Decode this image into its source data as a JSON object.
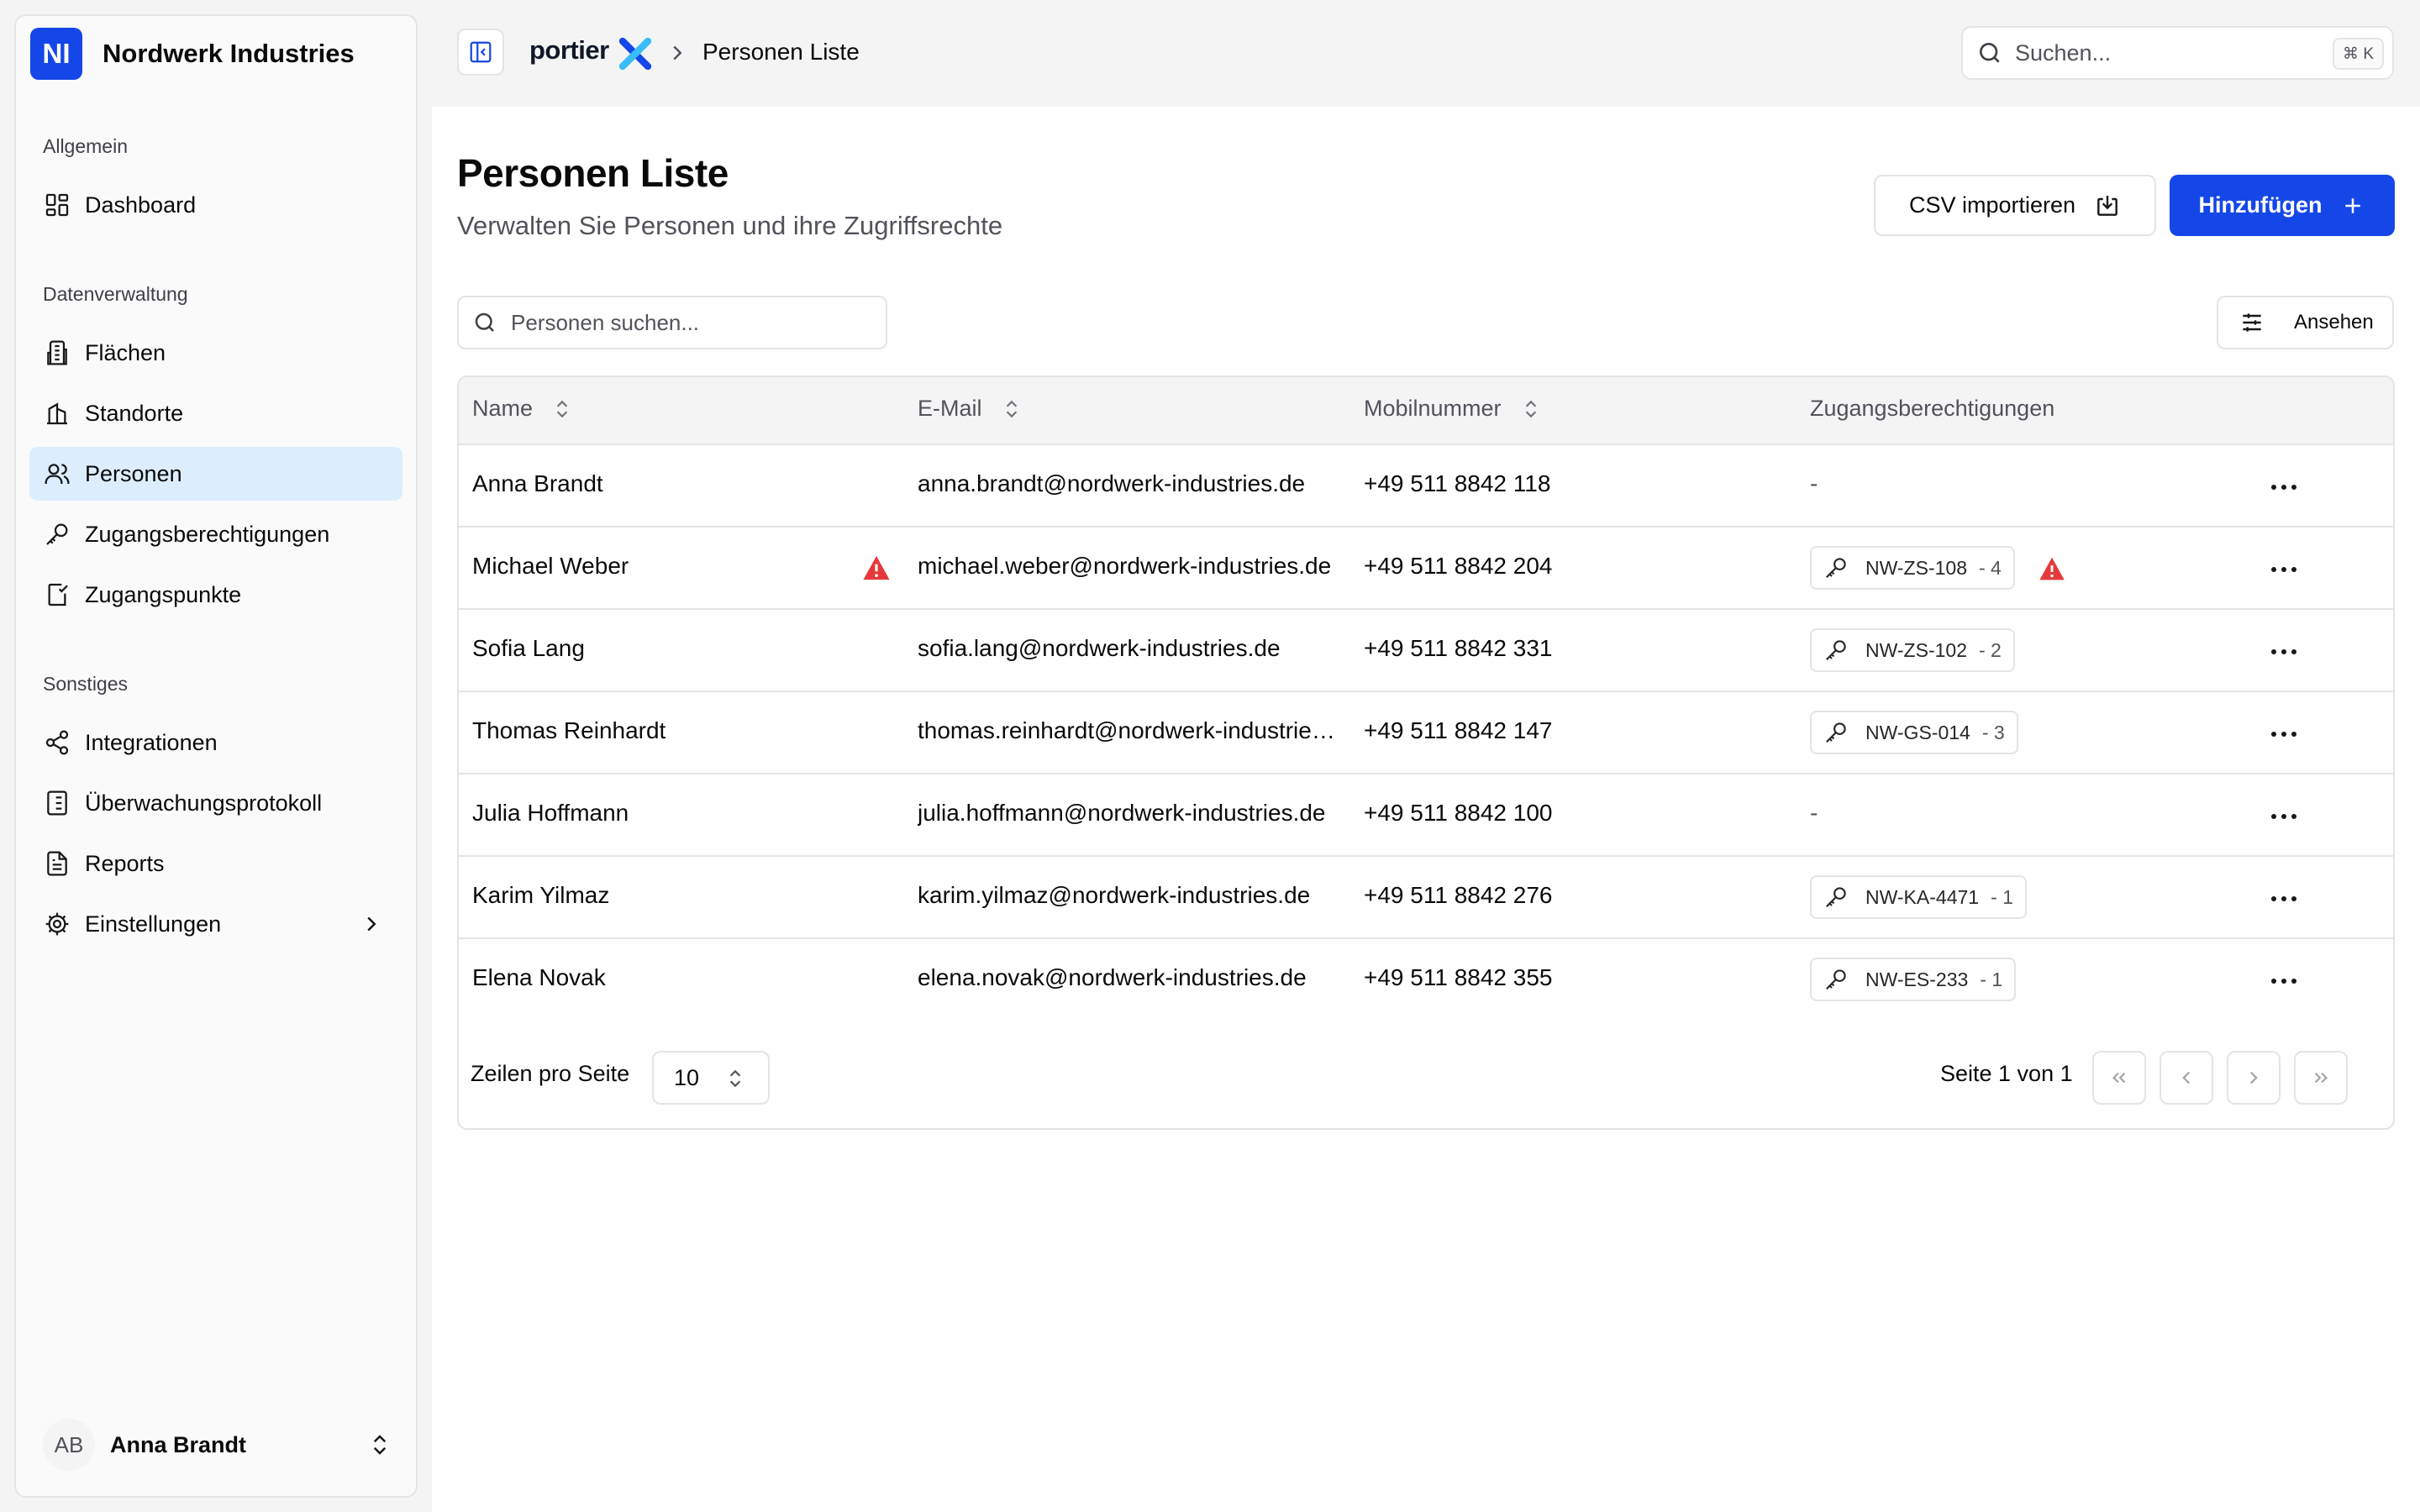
{
  "sidebar": {
    "brand_initials": "NI",
    "brand_name": "Nordwerk Industries",
    "groups": [
      {
        "label": "Allgemein"
      },
      {
        "label": "Datenverwaltung"
      },
      {
        "label": "Sonstiges"
      }
    ],
    "items": [
      {
        "label": "Dashboard",
        "icon": "dashboard-icon"
      },
      {
        "label": "Flächen",
        "icon": "building-icon"
      },
      {
        "label": "Standorte",
        "icon": "buildings-icon"
      },
      {
        "label": "Personen",
        "icon": "users-icon",
        "active": true
      },
      {
        "label": "Zugangsberechtigungen",
        "icon": "key-icon"
      },
      {
        "label": "Zugangspunkte",
        "icon": "door-icon"
      },
      {
        "label": "Integrationen",
        "icon": "share-icon"
      },
      {
        "label": "Überwachungsprotokoll",
        "icon": "log-icon"
      },
      {
        "label": "Reports",
        "icon": "report-icon"
      },
      {
        "label": "Einstellungen",
        "icon": "gear-icon"
      }
    ],
    "user": {
      "initials": "AB",
      "name": "Anna Brandt"
    }
  },
  "topbar": {
    "logo_text": "portier",
    "breadcrumb": "Personen Liste",
    "search_placeholder": "Suchen...",
    "search_shortcut": "⌘ K"
  },
  "page": {
    "title": "Personen Liste",
    "subtitle": "Verwalten Sie Personen und ihre Zugriffsrechte",
    "csv_button": "CSV importieren",
    "add_button": "Hinzufügen",
    "filter_placeholder": "Personen suchen...",
    "view_button": "Ansehen"
  },
  "table": {
    "columns": [
      "Name",
      "E-Mail",
      "Mobilnummer",
      "Zugangsberechtigungen"
    ],
    "rows": [
      {
        "name": "Anna Brandt",
        "email": "anna.brandt@nordwerk-industries.de",
        "phone": "+49 511 8842 118",
        "access": "-",
        "access_count": ""
      },
      {
        "name": "Michael Weber",
        "email": "michael.weber@nordwerk-industries.de",
        "phone": "+49 511 8842 204",
        "access": "NW-ZS-108",
        "access_count": "- 4",
        "warning": true
      },
      {
        "name": "Sofia Lang",
        "email": "sofia.lang@nordwerk-industries.de",
        "phone": "+49 511 8842 331",
        "access": "NW-ZS-102",
        "access_count": "- 2"
      },
      {
        "name": "Thomas Reinhardt",
        "email": "thomas.reinhardt@nordwerk-industries.de",
        "phone": "+49 511 8842 147",
        "access": "NW-GS-014",
        "access_count": "- 3"
      },
      {
        "name": "Julia Hoffmann",
        "email": "julia.hoffmann@nordwerk-industries.de",
        "phone": "+49 511 8842 100",
        "access": "-",
        "access_count": ""
      },
      {
        "name": "Karim Yilmaz",
        "email": "karim.yilmaz@nordwerk-industries.de",
        "phone": "+49 511 8842 276",
        "access": "NW-KA-4471",
        "access_count": "- 1"
      },
      {
        "name": "Elena Novak",
        "email": "elena.novak@nordwerk-industries.de",
        "phone": "+49 511 8842 355",
        "access": "NW-ES-233",
        "access_count": "- 1"
      }
    ]
  },
  "pagination": {
    "rows_label": "Zeilen pro Seite",
    "rows_value": "10",
    "page_info": "Seite 1 von 1"
  },
  "colors": {
    "accent": "#1547e8",
    "active_nav": "#dcedfd",
    "warning": "#e5393b"
  }
}
